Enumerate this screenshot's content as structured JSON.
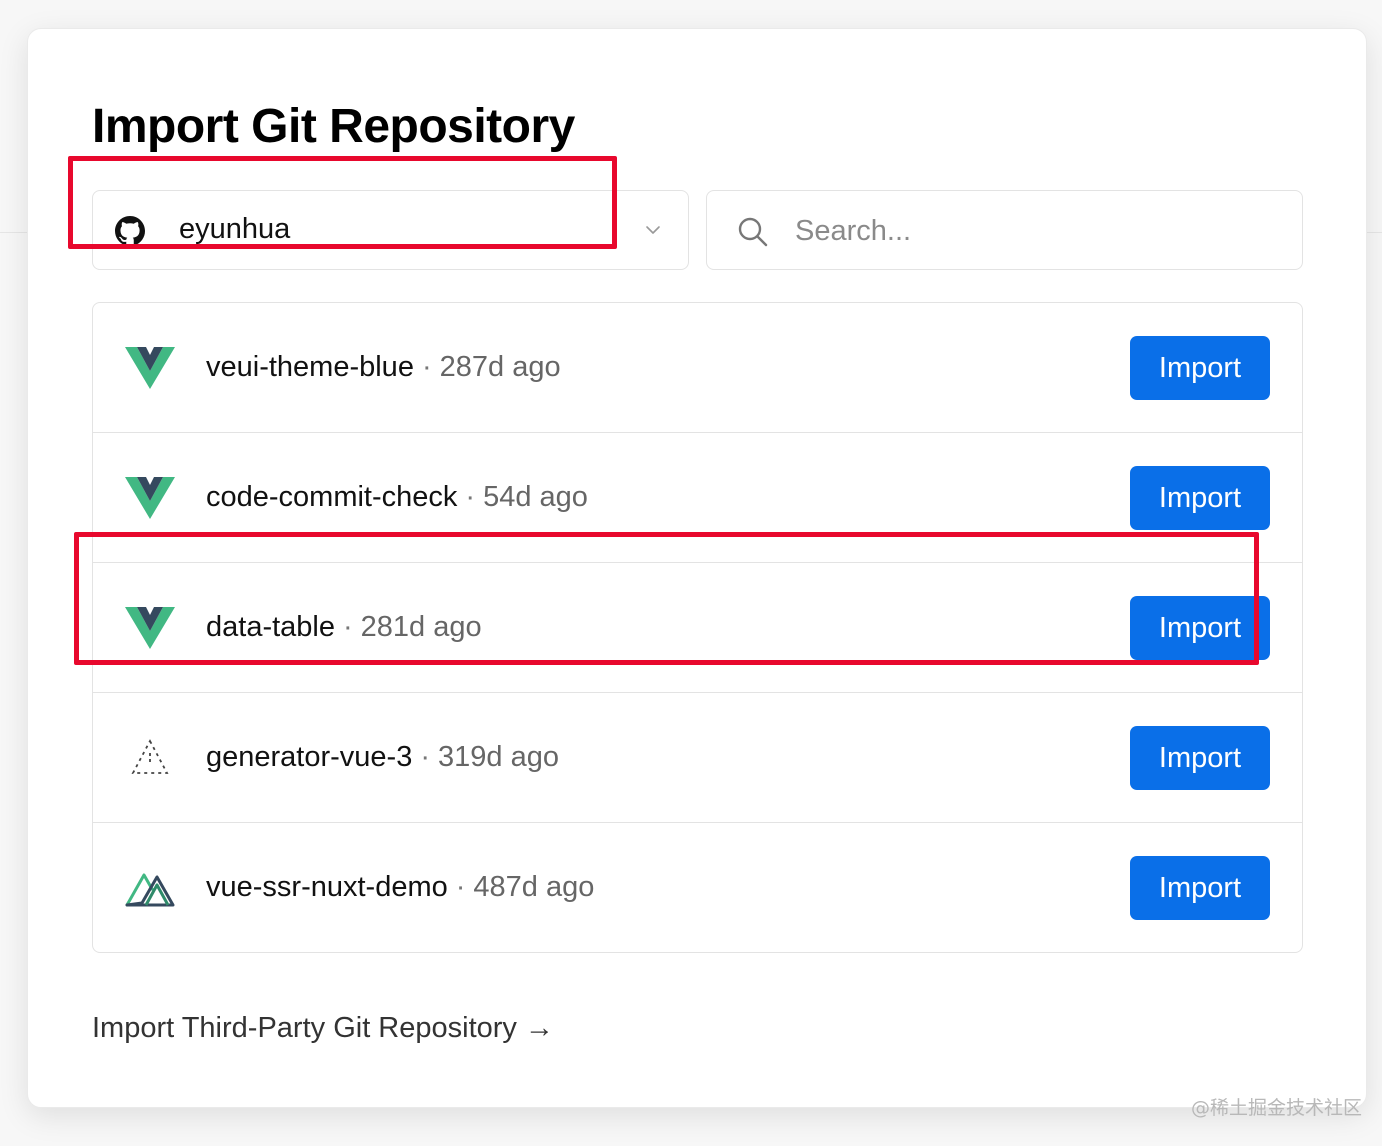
{
  "page": {
    "title": "Import Git Repository",
    "third_party_link": "Import Third-Party Git Repository",
    "third_party_arrow": "→"
  },
  "account": {
    "name": "eyunhua",
    "icon": "github-icon"
  },
  "search": {
    "placeholder": "Search...",
    "value": ""
  },
  "repos": [
    {
      "name": "veui-theme-blue",
      "separator": "·",
      "age": "287d ago",
      "icon": "vue-logo-icon",
      "button": "Import"
    },
    {
      "name": "code-commit-check",
      "separator": "·",
      "age": "54d ago",
      "icon": "vue-logo-icon",
      "button": "Import"
    },
    {
      "name": "data-table",
      "separator": "·",
      "age": "281d ago",
      "icon": "vue-logo-icon",
      "button": "Import"
    },
    {
      "name": "generator-vue-3",
      "separator": "·",
      "age": "319d ago",
      "icon": "dotted-triangle-icon",
      "button": "Import"
    },
    {
      "name": "vue-ssr-nuxt-demo",
      "separator": "·",
      "age": "487d ago",
      "icon": "nuxt-logo-icon",
      "button": "Import"
    }
  ],
  "colors": {
    "primary_button": "#0a6fe8",
    "highlight": "#e8082d",
    "vue_green": "#41b883",
    "vue_dark": "#35495e"
  },
  "watermark": "@稀土掘金技术社区"
}
